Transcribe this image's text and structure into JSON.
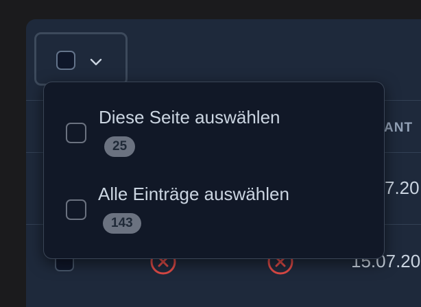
{
  "table": {
    "header_partial": "ANT",
    "row_dates": [
      "7.20",
      "15.07.20"
    ]
  },
  "dropdown": {
    "options": [
      {
        "label": "Diese Seite auswählen",
        "count": "25"
      },
      {
        "label": "Alle Einträge auswählen",
        "count": "143"
      }
    ]
  },
  "icons": {
    "trigger": "chevron-down-icon",
    "status": "x-circle-icon"
  },
  "colors": {
    "danger": "#dc4a46",
    "badge_bg": "#6b7280",
    "panel_bg": "#1e293b",
    "dropdown_bg": "#111827"
  }
}
